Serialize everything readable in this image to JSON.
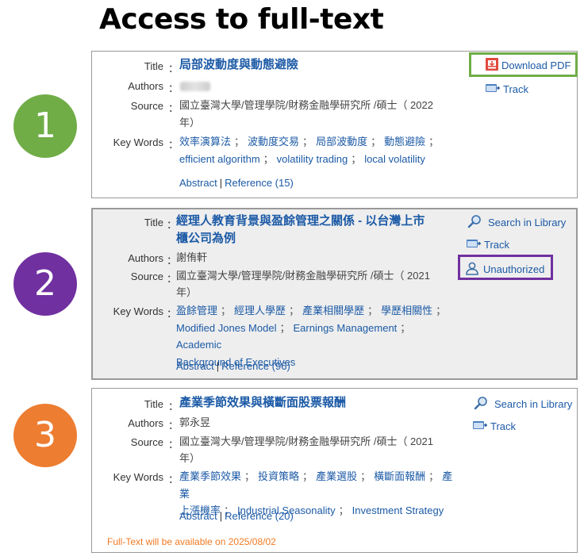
{
  "header": {
    "title": "Access to full-text"
  },
  "badges": [
    "1",
    "2",
    "3"
  ],
  "labels": {
    "title": "Title",
    "authors": "Authors",
    "source": "Source",
    "keywords": "Key Words",
    "colon": "："
  },
  "records": [
    {
      "title": "局部波動度與動態避險",
      "authors": "",
      "source_line1": "國立臺灣大學/管理學院/財務金融學研究所 /碩士（ 2022",
      "source_line2": "年）",
      "keywords": [
        "效率演算法",
        "波動度交易",
        "局部波動度",
        "動態避險",
        "efficient algorithm",
        "volatility trading",
        "local volatility"
      ],
      "abstract_label": "Abstract",
      "reference_label": "Reference (15)",
      "actions": {
        "download_pdf": "Download PDF",
        "track": "Track"
      }
    },
    {
      "title_line1": "經理人教育背景與盈餘管理之關係 - 以台灣上市",
      "title_line2": "櫃公司為例",
      "authors": "謝侑軒",
      "source_line1": "國立臺灣大學/管理學院/財務金融學研究所 /碩士（ 2021",
      "source_line2": "年）",
      "keywords": [
        "盈餘管理",
        "經理人學歷",
        "產業相關學歷",
        "學歷相關性",
        "Modified Jones Model",
        "Earnings Management",
        "Academic",
        "Background of Executives"
      ],
      "abstract_label": "Abstract",
      "reference_label": "Reference (96)",
      "actions": {
        "search_library": "Search in Library",
        "track": "Track",
        "unauthorized": "Unauthorized"
      }
    },
    {
      "title": "產業季節效果與橫斷面股票報酬",
      "authors": "郭永昱",
      "source_line1": "國立臺灣大學/管理學院/財務金融學研究所 /碩士（ 2021",
      "source_line2": "年）",
      "keywords": [
        "產業季節效果",
        "投資策略",
        "產業選股",
        "橫斷面報酬",
        "產業",
        "上漲機率",
        "Industrial Seasonality",
        "Investment Strategy"
      ],
      "abstract_label": "Abstract",
      "reference_label": "Reference (20)",
      "actions": {
        "search_library": "Search in Library",
        "track": "Track"
      },
      "availability": "Full-Text will be available on 2025/08/02"
    }
  ],
  "colors": {
    "green": "#70ad47",
    "purple": "#7030a0",
    "orange": "#ed7d31",
    "link": "#1c5aa6"
  },
  "icons": [
    "pdf-icon",
    "track-icon",
    "search-icon",
    "user-icon"
  ]
}
